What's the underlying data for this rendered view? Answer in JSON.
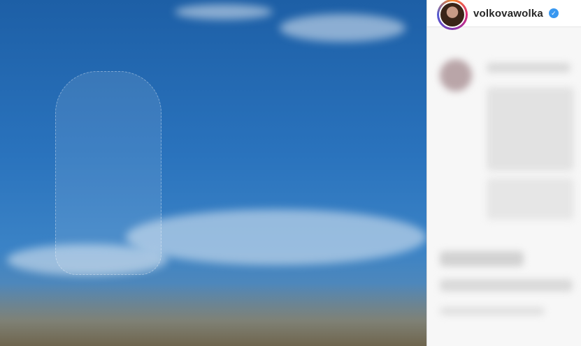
{
  "post": {
    "username": "volkovawolka",
    "verified": true,
    "verified_glyph": "✓",
    "media": "image"
  },
  "colors": {
    "accent_verified": "#3897f0",
    "panel_bg": "#f7f7f7",
    "border": "#dbdbdb"
  },
  "icons": [
    "verified-badge-icon",
    "avatar"
  ]
}
